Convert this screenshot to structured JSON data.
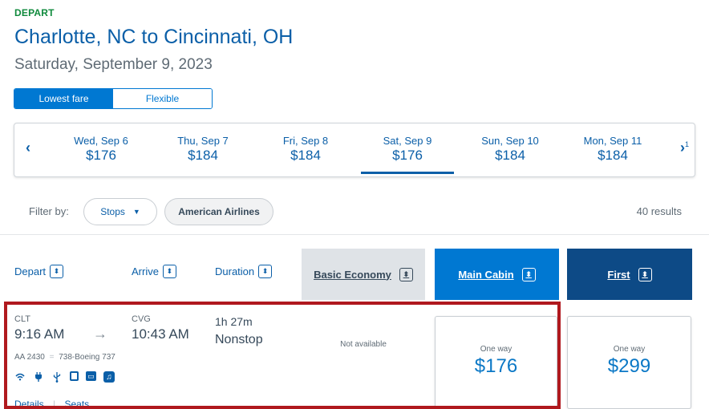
{
  "header": {
    "depart_label": "DEPART",
    "route": "Charlotte, NC to Cincinnati, OH",
    "date": "Saturday, September 9, 2023"
  },
  "fare_toggle": {
    "options": [
      "Lowest fare",
      "Flexible"
    ],
    "selected": "Lowest fare"
  },
  "date_strip": {
    "prev_icon": "chevron-left-icon",
    "next_icon": "chevron-right-icon",
    "next_label": "1",
    "dates": [
      {
        "date": "Wed, Sep 6",
        "price": "$176"
      },
      {
        "date": "Thu, Sep 7",
        "price": "$184"
      },
      {
        "date": "Fri, Sep 8",
        "price": "$184"
      },
      {
        "date": "Sat, Sep 9",
        "price": "$176",
        "selected": true
      },
      {
        "date": "Sun, Sep 10",
        "price": "$184"
      },
      {
        "date": "Mon, Sep 11",
        "price": "$184"
      }
    ]
  },
  "filter": {
    "label": "Filter by:",
    "stops_chip": "Stops",
    "airline_chip": "American Airlines",
    "results": "40 results"
  },
  "columns": {
    "depart": "Depart",
    "arrive": "Arrive",
    "duration": "Duration",
    "basic_economy": "Basic Economy",
    "main_cabin": "Main Cabin",
    "first": "First"
  },
  "flight": {
    "origin_code": "CLT",
    "depart_time": "9:16 AM",
    "destination_code": "CVG",
    "arrive_time": "10:43 AM",
    "duration": "1h 27m",
    "stops": "Nonstop",
    "flight_number": "AA 2430",
    "aircraft": "738-Boeing 737",
    "amenities": [
      "wifi-icon",
      "power-icon",
      "usb-icon",
      "phone-icon",
      "entertainment-icon",
      "music-icon"
    ],
    "basic_economy": "Not available",
    "main_cabin": {
      "label": "One way",
      "price": "$176"
    },
    "first": {
      "label": "One way",
      "price": "$299"
    },
    "details_link": "Details",
    "seats_link": "Seats"
  },
  "colors": {
    "brand_blue": "#0078d2",
    "dark_blue": "#0d4a86",
    "depart_green": "#0f8a3c",
    "highlight_red": "#b0191e"
  }
}
